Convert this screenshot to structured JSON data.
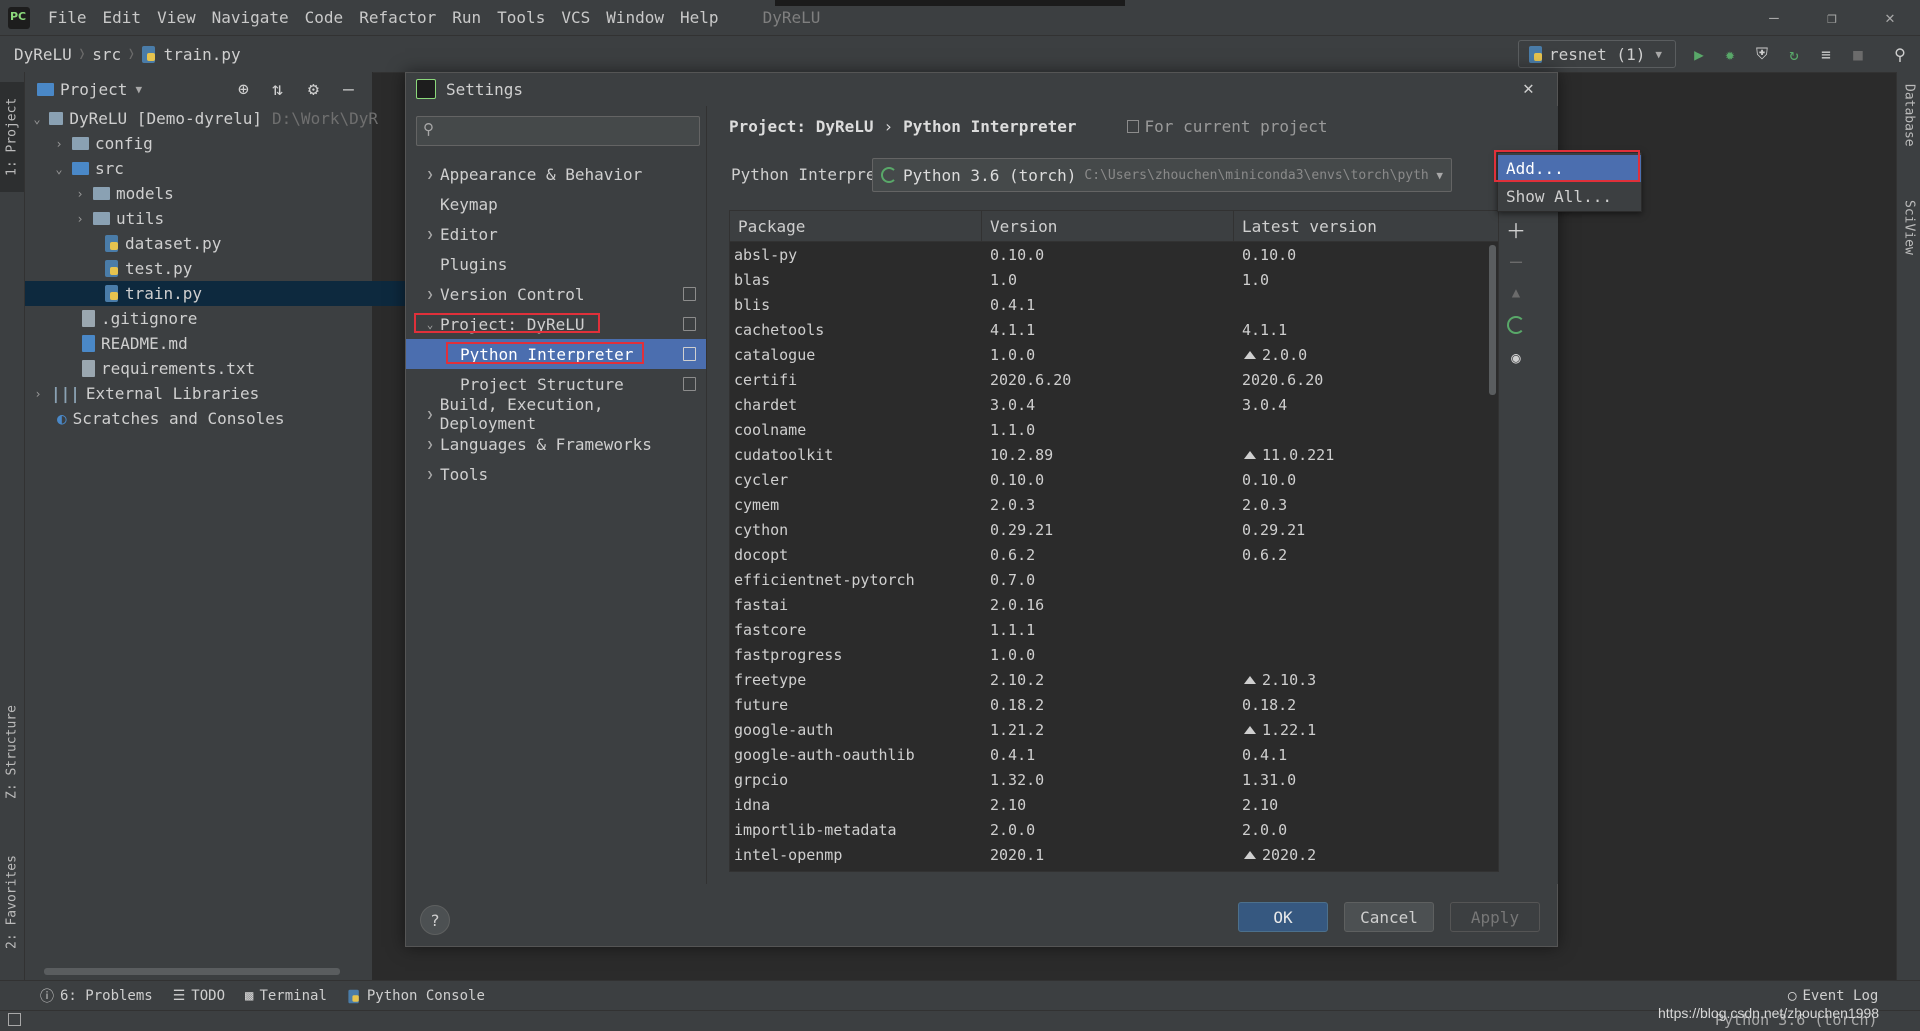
{
  "menubar": {
    "items": [
      "File",
      "Edit",
      "View",
      "Navigate",
      "Code",
      "Refactor",
      "Run",
      "Tools",
      "VCS",
      "Window",
      "Help"
    ],
    "app_title": "DyReLU"
  },
  "navbar": {
    "crumbs": [
      "DyReLU",
      "src",
      "train.py"
    ],
    "run_config": "resnet (1)"
  },
  "left_strip": {
    "project_tab": "1: Project",
    "structure_tab": "Z: Structure",
    "favorites_tab": "2: Favorites"
  },
  "right_strip": {
    "database_tab": "Database",
    "sciview_tab": "SciView"
  },
  "project_panel": {
    "title": "Project",
    "tree": [
      {
        "label": "DyReLU [Demo-dyrelu]",
        "hint": "D:\\Work\\DyR"
      },
      {
        "label": "config"
      },
      {
        "label": "src"
      },
      {
        "label": "models"
      },
      {
        "label": "utils"
      },
      {
        "label": "dataset.py"
      },
      {
        "label": "test.py"
      },
      {
        "label": "train.py"
      },
      {
        "label": ".gitignore"
      },
      {
        "label": "README.md"
      },
      {
        "label": "requirements.txt"
      },
      {
        "label": "External Libraries"
      },
      {
        "label": "Scratches and Consoles"
      }
    ]
  },
  "dialog": {
    "title": "Settings",
    "sidebar": [
      {
        "label": "Appearance & Behavior"
      },
      {
        "label": "Keymap"
      },
      {
        "label": "Editor"
      },
      {
        "label": "Plugins"
      },
      {
        "label": "Version Control"
      },
      {
        "label": "Project: DyReLU"
      },
      {
        "label": "Python Interpreter"
      },
      {
        "label": "Project Structure"
      },
      {
        "label": "Build, Execution, Deployment"
      },
      {
        "label": "Languages & Frameworks"
      },
      {
        "label": "Tools"
      }
    ],
    "breadcrumb": {
      "project": "Project: DyReLU",
      "sep": "›",
      "page": "Python Interpreter",
      "scope": "For current project"
    },
    "interpreter": {
      "label": "Python Interpreter:",
      "name": "Python 3.6 (torch)",
      "path": "C:\\Users\\zhouchen\\miniconda3\\envs\\torch\\pyth"
    },
    "table": {
      "headers": [
        "Package",
        "Version",
        "Latest version"
      ],
      "rows": [
        {
          "pkg": "absl-py",
          "ver": "0.10.0",
          "latest": "0.10.0",
          "up": false
        },
        {
          "pkg": "blas",
          "ver": "1.0",
          "latest": "1.0",
          "up": false
        },
        {
          "pkg": "blis",
          "ver": "0.4.1",
          "latest": "",
          "up": false
        },
        {
          "pkg": "cachetools",
          "ver": "4.1.1",
          "latest": "4.1.1",
          "up": false
        },
        {
          "pkg": "catalogue",
          "ver": "1.0.0",
          "latest": "2.0.0",
          "up": true
        },
        {
          "pkg": "certifi",
          "ver": "2020.6.20",
          "latest": "2020.6.20",
          "up": false
        },
        {
          "pkg": "chardet",
          "ver": "3.0.4",
          "latest": "3.0.4",
          "up": false
        },
        {
          "pkg": "coolname",
          "ver": "1.1.0",
          "latest": "",
          "up": false
        },
        {
          "pkg": "cudatoolkit",
          "ver": "10.2.89",
          "latest": "11.0.221",
          "up": true
        },
        {
          "pkg": "cycler",
          "ver": "0.10.0",
          "latest": "0.10.0",
          "up": false
        },
        {
          "pkg": "cymem",
          "ver": "2.0.3",
          "latest": "2.0.3",
          "up": false
        },
        {
          "pkg": "cython",
          "ver": "0.29.21",
          "latest": "0.29.21",
          "up": false
        },
        {
          "pkg": "docopt",
          "ver": "0.6.2",
          "latest": "0.6.2",
          "up": false
        },
        {
          "pkg": "efficientnet-pytorch",
          "ver": "0.7.0",
          "latest": "",
          "up": false
        },
        {
          "pkg": "fastai",
          "ver": "2.0.16",
          "latest": "",
          "up": false
        },
        {
          "pkg": "fastcore",
          "ver": "1.1.1",
          "latest": "",
          "up": false
        },
        {
          "pkg": "fastprogress",
          "ver": "1.0.0",
          "latest": "",
          "up": false
        },
        {
          "pkg": "freetype",
          "ver": "2.10.2",
          "latest": "2.10.3",
          "up": true
        },
        {
          "pkg": "future",
          "ver": "0.18.2",
          "latest": "0.18.2",
          "up": false
        },
        {
          "pkg": "google-auth",
          "ver": "1.21.2",
          "latest": "1.22.1",
          "up": true
        },
        {
          "pkg": "google-auth-oauthlib",
          "ver": "0.4.1",
          "latest": "0.4.1",
          "up": false
        },
        {
          "pkg": "grpcio",
          "ver": "1.32.0",
          "latest": "1.31.0",
          "up": false
        },
        {
          "pkg": "idna",
          "ver": "2.10",
          "latest": "2.10",
          "up": false
        },
        {
          "pkg": "importlib-metadata",
          "ver": "2.0.0",
          "latest": "2.0.0",
          "up": false
        },
        {
          "pkg": "intel-openmp",
          "ver": "2020.1",
          "latest": "2020.2",
          "up": true
        }
      ]
    },
    "popup": {
      "add": "Add...",
      "show_all": "Show All..."
    },
    "buttons": {
      "ok": "OK",
      "cancel": "Cancel",
      "apply": "Apply",
      "help": "?"
    }
  },
  "bottom": {
    "problems": "6: Problems",
    "todo": "TODO",
    "terminal": "Terminal",
    "python_console": "Python Console",
    "event_log": "Event Log",
    "status_right": "Python 3.6 (torch)",
    "watermark": "https://blog.csdn.net/zhouchen1998"
  },
  "colors": {
    "accent": "#4b6eaf",
    "highlight": "#e0303a",
    "run_green": "#59a869"
  }
}
